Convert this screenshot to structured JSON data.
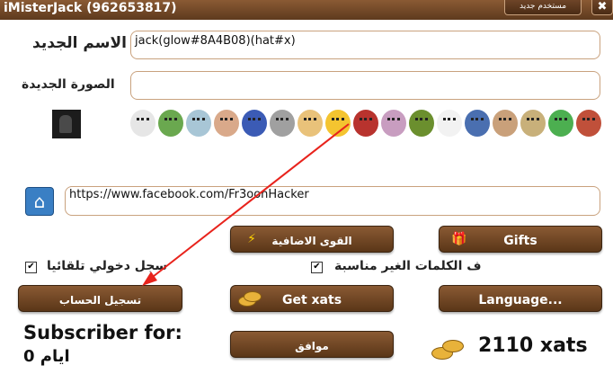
{
  "window": {
    "title": "iMisterJack (962653817)",
    "new_user_label": "مستخدم جديد",
    "close_glyph": "✖"
  },
  "form": {
    "name_label": "الاسم الجديد",
    "name_value": "jack(glow#8A4B08)(hat#x)",
    "picture_label": "الصورة الجديدة",
    "picture_value": "",
    "homepage_value": "https://www.facebook.com/Fr3oonHacker"
  },
  "avatars": [
    {
      "name": "avatar-option-1",
      "color": "#e6e6e6"
    },
    {
      "name": "avatar-option-2",
      "color": "#6aa84f"
    },
    {
      "name": "avatar-option-3",
      "color": "#a8c6d6"
    },
    {
      "name": "avatar-option-4",
      "color": "#d9a98a"
    },
    {
      "name": "avatar-option-5",
      "color": "#3b5bb5"
    },
    {
      "name": "avatar-option-6",
      "color": "#a0a0a0"
    },
    {
      "name": "avatar-option-7",
      "color": "#e9c27a"
    },
    {
      "name": "avatar-option-8",
      "color": "#f4c430"
    },
    {
      "name": "avatar-option-9",
      "color": "#b8332e"
    },
    {
      "name": "avatar-option-10",
      "color": "#c89dc0"
    },
    {
      "name": "avatar-option-11",
      "color": "#6b8f2e"
    },
    {
      "name": "avatar-option-12",
      "color": "#f2f2f2"
    },
    {
      "name": "avatar-option-13",
      "color": "#4a6fb0"
    },
    {
      "name": "avatar-option-14",
      "color": "#c9a07a"
    },
    {
      "name": "avatar-option-15",
      "color": "#c8b07a"
    },
    {
      "name": "avatar-option-16",
      "color": "#4caf50"
    },
    {
      "name": "avatar-option-17",
      "color": "#c0503a"
    }
  ],
  "buttons": {
    "powers": "القوى الاضافية",
    "gifts": "Gifts",
    "register": "تسجيل الحساب",
    "get_xats": "Get xats",
    "language": "Language...",
    "ok": "موافق"
  },
  "checkboxes": {
    "auto_login": {
      "label": "سجل دخولي تلقائيا",
      "checked": true
    },
    "bad_words": {
      "label": "ف الكلمات الغير مناسبة",
      "checked": true
    }
  },
  "subscriber": {
    "label": "Subscriber for:",
    "days": "ايام 0"
  },
  "balance": "2110 xats",
  "colors": {
    "accent": "#6e4528",
    "border": "#c9a27e",
    "arrow": "#e8231c"
  }
}
